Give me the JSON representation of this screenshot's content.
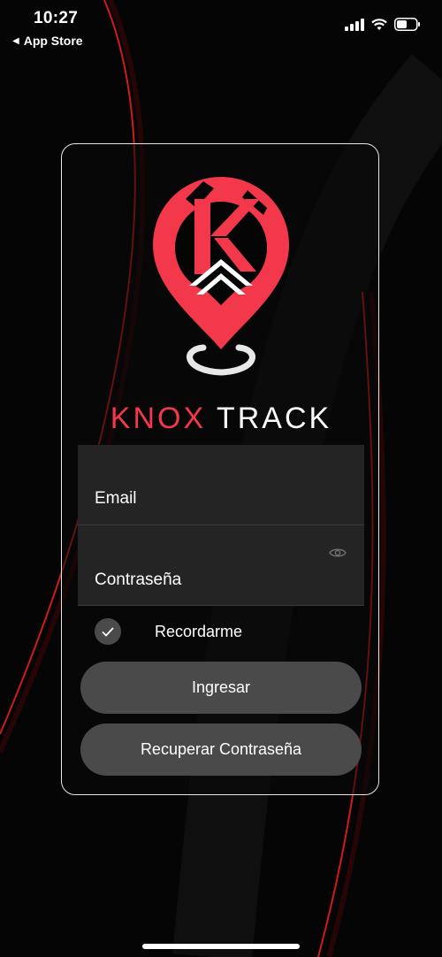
{
  "status_bar": {
    "time": "10:27",
    "back_label": "App Store",
    "icons": [
      "signal-icon",
      "wifi-icon",
      "battery-icon"
    ]
  },
  "brand": {
    "knox": "KNOX",
    "track": "TRACK",
    "accent_color": "#f2384a"
  },
  "form": {
    "email_label": "Email",
    "password_label": "Contraseña",
    "remember_label": "Recordarme",
    "remember_checked": true
  },
  "actions": {
    "login_label": "Ingresar",
    "recover_label": "Recuperar Contraseña"
  }
}
